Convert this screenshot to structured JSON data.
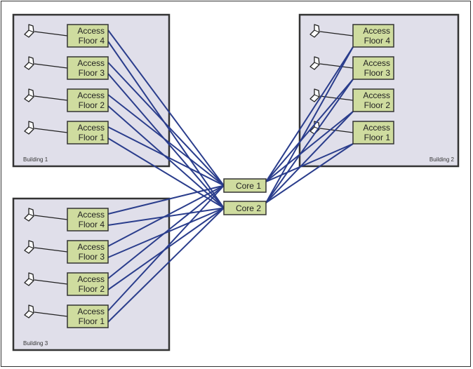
{
  "diagram": {
    "type": "network-topology",
    "colors": {
      "building_fill": "#e0dfea",
      "switch_fill": "#cfdc9f",
      "uplink": "#2a3d8c",
      "border": "#333333"
    },
    "core": [
      {
        "id": "core1",
        "label": "Core 1"
      },
      {
        "id": "core2",
        "label": "Core 2"
      }
    ],
    "buildings": [
      {
        "id": "b1",
        "label": "Building 1",
        "switches": [
          {
            "line1": "Access",
            "line2": "Floor 4"
          },
          {
            "line1": "Access",
            "line2": "Floor 3"
          },
          {
            "line1": "Access",
            "line2": "Floor 2"
          },
          {
            "line1": "Access",
            "line2": "Floor 1"
          }
        ]
      },
      {
        "id": "b2",
        "label": "Building 2",
        "switches": [
          {
            "line1": "Access",
            "line2": "Floor 4"
          },
          {
            "line1": "Access",
            "line2": "Floor 3"
          },
          {
            "line1": "Access",
            "line2": "Floor 2"
          },
          {
            "line1": "Access",
            "line2": "Floor 1"
          }
        ]
      },
      {
        "id": "b3",
        "label": "Building 3",
        "switches": [
          {
            "line1": "Access",
            "line2": "Floor 4"
          },
          {
            "line1": "Access",
            "line2": "Floor 3"
          },
          {
            "line1": "Access",
            "line2": "Floor 2"
          },
          {
            "line1": "Access",
            "line2": "Floor 1"
          }
        ]
      }
    ],
    "host_icon": "laptop-icon",
    "links_note": "each access switch dual-homed to Core 1 and Core 2"
  }
}
